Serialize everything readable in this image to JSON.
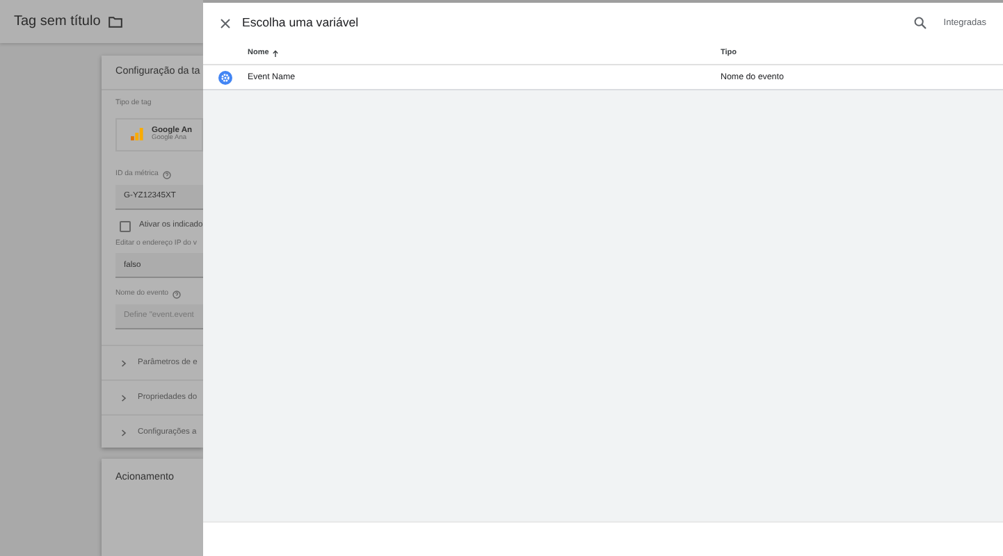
{
  "page": {
    "title": "Tag sem título",
    "tag_config": {
      "title": "Configuração da ta",
      "tag_type_label": "Tipo de tag",
      "tag_type_name": "Google An",
      "tag_type_sub": "Google Ana",
      "metric_id_label": "ID da métrica",
      "metric_id_value": "G-YZ12345XT",
      "checkbox": {
        "label": "Ativar os indicado",
        "checked": false
      },
      "ip_label": "Editar o endereço IP do v",
      "ip_value": "falso",
      "event_name_label": "Nome do evento",
      "event_name_placeholder": "Define \"event.event",
      "sections": [
        {
          "label": "Parâmetros de e",
          "expanded": false
        },
        {
          "label": "Propriedades do",
          "expanded": false
        },
        {
          "label": "Configurações a",
          "expanded": false
        }
      ]
    },
    "trigger_title": "Acionamento"
  },
  "variable_picker": {
    "title": "Escolha uma variável",
    "filter": "Integradas",
    "columns": [
      {
        "label": "Nome",
        "sorted": true
      },
      {
        "label": "Tipo",
        "sorted": false
      }
    ],
    "rows": [
      {
        "name": "Event Name",
        "type": "Nome do evento"
      }
    ]
  }
}
